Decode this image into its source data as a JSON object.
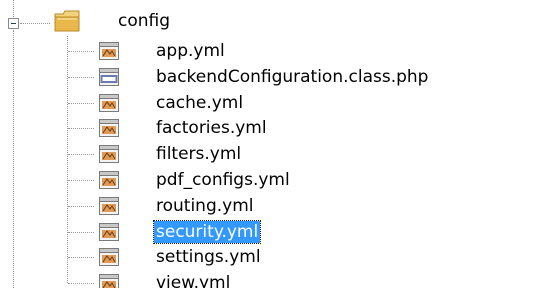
{
  "tree": {
    "folder": {
      "label": "config",
      "icon": "folder-icon",
      "expanded": true,
      "expander_icon": "minus-box-icon"
    },
    "files": [
      {
        "name": "app.yml",
        "icon": "yml-file-icon",
        "selected": false
      },
      {
        "name": "backendConfiguration.class.php",
        "icon": "php-file-icon",
        "selected": false
      },
      {
        "name": "cache.yml",
        "icon": "yml-file-icon",
        "selected": false
      },
      {
        "name": "factories.yml",
        "icon": "yml-file-icon",
        "selected": false
      },
      {
        "name": "filters.yml",
        "icon": "yml-file-icon",
        "selected": false
      },
      {
        "name": "pdf_configs.yml",
        "icon": "yml-file-icon",
        "selected": false
      },
      {
        "name": "routing.yml",
        "icon": "yml-file-icon",
        "selected": false
      },
      {
        "name": "security.yml",
        "icon": "yml-file-icon",
        "selected": true
      },
      {
        "name": "settings.yml",
        "icon": "yml-file-icon",
        "selected": false
      },
      {
        "name": "view.yml",
        "icon": "yml-file-icon",
        "selected": false
      }
    ],
    "colors": {
      "selection": "#3399ff",
      "selection_text": "#ffffff",
      "folder": "#e8b84a",
      "yml_icon": "#d98a3a",
      "php_icon": "#6a7bb0"
    }
  }
}
